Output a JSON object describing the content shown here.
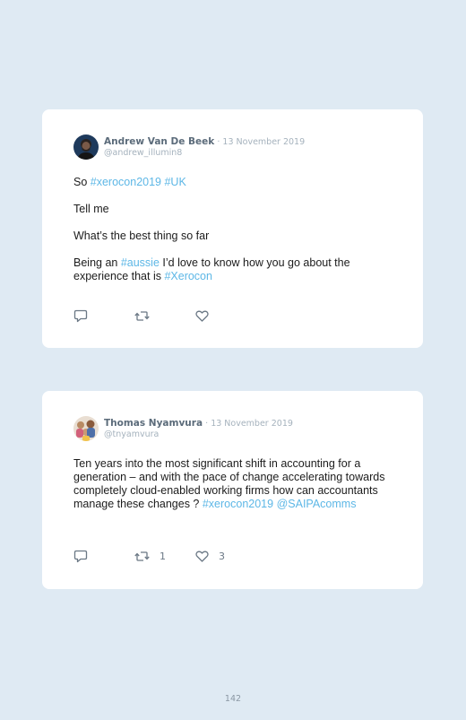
{
  "tweets": [
    {
      "display_name": "Andrew Van De Beek",
      "separator": "·",
      "date": "13 November 2019",
      "handle": "@andrew_illumin8",
      "avatar": "andrew-avatar",
      "paragraph_1": {
        "t1": "So ",
        "tag1": "#xerocon2019",
        "t2": " ",
        "tag2": "#UK"
      },
      "paragraph_2": "Tell me",
      "paragraph_3": "What’s the best thing so far",
      "paragraph_4": {
        "t1": "Being an ",
        "tag1": "#aussie",
        "t2": " I’d love to know how you go about the experience that is ",
        "tag2": "#Xerocon"
      },
      "actions": {
        "reply_icon": "reply-icon",
        "retweet_icon": "retweet-icon",
        "like_icon": "heart-icon"
      }
    },
    {
      "display_name": "Thomas Nyamvura",
      "separator": "·",
      "date": "13 November 2019",
      "handle": "@tnyamvura",
      "avatar": "thomas-avatar",
      "paragraph_1": {
        "t1": "Ten years into the most significant shift in accounting for a generation – and with the pace of change accelerating towards completely cloud-enabled working firms how can accountants manage these changes ? ",
        "tag1": "#xerocon2019",
        "t2": " ",
        "tag2": "@SAIPAcomms"
      },
      "actions": {
        "reply_icon": "reply-icon",
        "retweet_icon": "retweet-icon",
        "retweet_count": "1",
        "like_icon": "heart-icon",
        "like_count": "3"
      }
    }
  ],
  "page_number": "142",
  "colors": {
    "background": "#dfeaf3",
    "card": "#ffffff",
    "hashtag": "#5db7e6",
    "name": "#5b6b7a",
    "meta": "#a5b2bd"
  }
}
